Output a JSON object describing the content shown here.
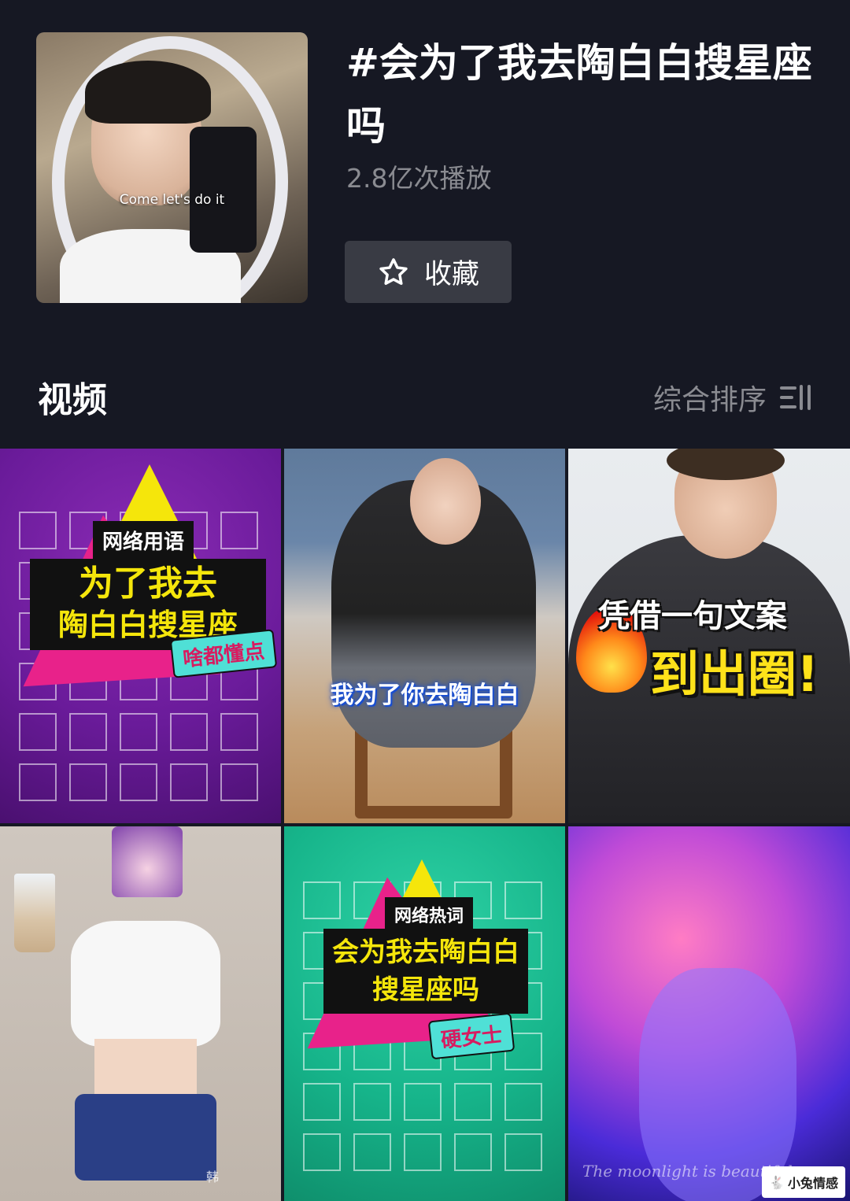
{
  "header": {
    "cover_caption": "Come let's do it",
    "title": "#会为了我去陶白白搜星座吗",
    "play_count": "2.8亿次播放",
    "favorite_label": "收藏",
    "favorite_icon": "star-outline-icon"
  },
  "section": {
    "title": "视频",
    "sort_label": "综合排序",
    "sort_icon": "filter-sort-icon"
  },
  "videos": [
    {
      "tag": "网络用语",
      "line1": "为了我去",
      "line2": "陶白白搜星座",
      "pill": "啥都懂点"
    },
    {
      "caption": "我为了你去陶白白"
    },
    {
      "line1": "凭借一句文案",
      "line2": "到出圈!"
    },
    {
      "label": "韩"
    },
    {
      "tag": "网络热词",
      "line1": "会为我去陶白白",
      "line2": "搜星座吗",
      "pill": "硬女士"
    },
    {
      "caption": "The moonlight is beautiful"
    }
  ],
  "watermark": {
    "text": "小兔情感"
  },
  "colors": {
    "background": "#161823",
    "secondary_text": "#8a8b91",
    "button_bg": "#393b44"
  }
}
